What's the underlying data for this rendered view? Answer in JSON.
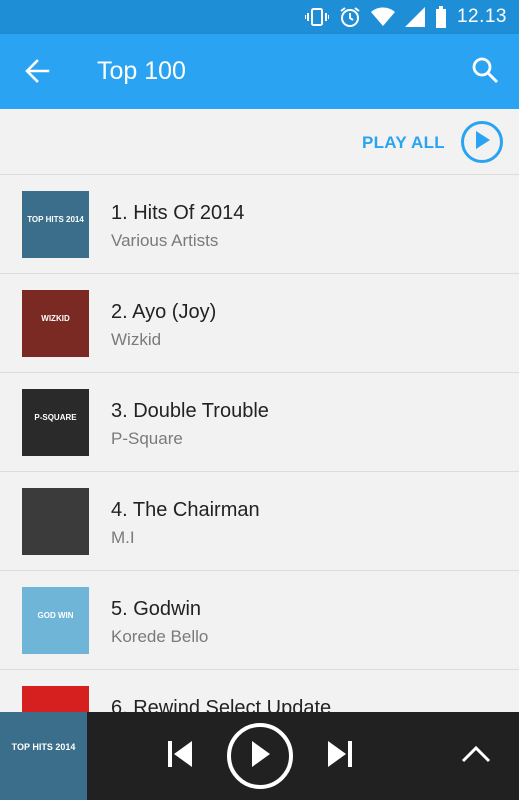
{
  "status_bar": {
    "time": "12.13",
    "icons": [
      "vibrate-icon",
      "alarm-icon",
      "wifi-icon",
      "signal-icon",
      "battery-icon"
    ]
  },
  "app_bar": {
    "title": "Top 100",
    "back_icon": "arrow-back-icon",
    "search_icon": "search-icon"
  },
  "play_all": {
    "label": "PLAY ALL",
    "icon": "play-circle-icon"
  },
  "tracks": [
    {
      "title": "1. Hits Of 2014",
      "artist": "Various Artists",
      "art_text": "TOP HITS 2014",
      "art_color": "#3a6e8a"
    },
    {
      "title": "2. Ayo (Joy)",
      "artist": "Wizkid",
      "art_text": "WIZKID",
      "art_color": "#7a2a22"
    },
    {
      "title": "3. Double Trouble",
      "artist": "P-Square",
      "art_text": "P-SQUARE",
      "art_color": "#2a2a2a"
    },
    {
      "title": "4. The Chairman",
      "artist": "M.I",
      "art_text": "",
      "art_color": "#3b3b3b"
    },
    {
      "title": "5. Godwin",
      "artist": "Korede Bello",
      "art_text": "GOD WIN",
      "art_color": "#6fb5d8"
    },
    {
      "title": "6. Rewind Select Update",
      "artist": "",
      "art_text": "",
      "art_color": "#d62020"
    }
  ],
  "player": {
    "art_text": "TOP HITS 2014",
    "art_color": "#3a6e8a",
    "controls": [
      "skip-previous-icon",
      "play-icon",
      "skip-next-icon",
      "expand-up-icon"
    ]
  },
  "colors": {
    "status_bar": "#1e8fd6",
    "app_bar": "#2aa3f3",
    "accent": "#2aa3f3",
    "player_bg": "#212121"
  }
}
